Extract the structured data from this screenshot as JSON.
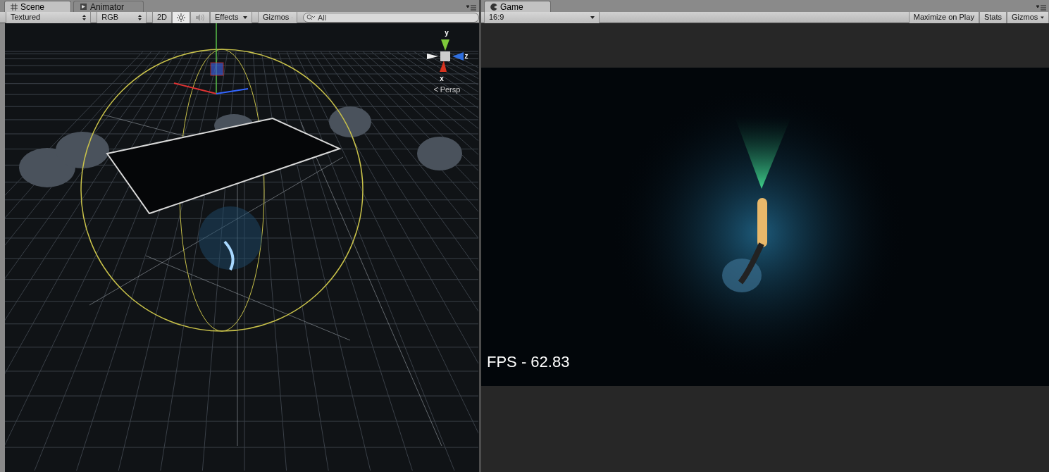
{
  "scene": {
    "tabs": [
      {
        "label": "Scene",
        "selected": true
      },
      {
        "label": "Animator",
        "selected": false
      }
    ],
    "toolbar": {
      "draw_mode": "Textured",
      "color_mode": "RGB",
      "mode_2d": {
        "label": "2D",
        "on": false
      },
      "lighting": {
        "on": true
      },
      "audio": {
        "on": false
      },
      "effects": "Effects",
      "gizmos": "Gizmos",
      "search": {
        "placeholder": "All"
      }
    },
    "orientation_gizmo": {
      "y_label": "y",
      "z_label": "z",
      "x_label": "x",
      "projection": "Persp"
    }
  },
  "game": {
    "tabs": [
      {
        "label": "Game",
        "selected": true
      }
    ],
    "toolbar": {
      "aspect": "16:9",
      "maximize_on_play": {
        "label": "Maximize on Play",
        "on": false
      },
      "stats": {
        "label": "Stats",
        "on": false
      },
      "gizmos": "Gizmos"
    },
    "fps_label": "FPS - 62.83"
  }
}
